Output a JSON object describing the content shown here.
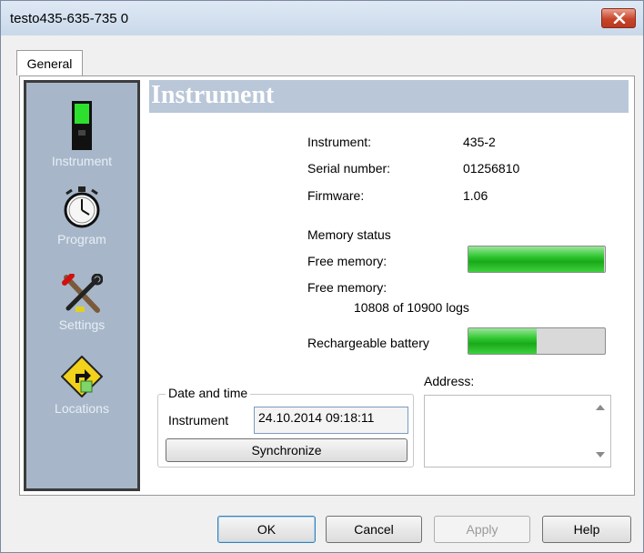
{
  "window": {
    "title": "testo435-635-735 0"
  },
  "tabs": [
    {
      "label": "General"
    }
  ],
  "sidebar": {
    "items": [
      {
        "label": "Instrument",
        "icon": "instrument-icon"
      },
      {
        "label": "Program",
        "icon": "stopwatch-icon"
      },
      {
        "label": "Settings",
        "icon": "tools-icon"
      },
      {
        "label": "Locations",
        "icon": "road-sign-icon"
      }
    ]
  },
  "panel": {
    "header": "Instrument",
    "info": {
      "instrument_label": "Instrument:",
      "instrument_value": "435-2",
      "serial_label": "Serial number:",
      "serial_value": "01256810",
      "firmware_label": "Firmware:",
      "firmware_value": "1.06"
    },
    "memory": {
      "heading": "Memory status",
      "free_memory_label": "Free memory:",
      "free_memory_fraction": 0.99,
      "free_memory_text_label": "Free memory:",
      "free_memory_text": "10808 of 10900 logs",
      "battery_label": "Rechargeable battery",
      "battery_fraction": 0.5
    },
    "datetime": {
      "group_title": "Date and time",
      "instrument_label": "Instrument",
      "value": "24.10.2014 09:18:11",
      "sync_button": "Synchronize"
    },
    "address": {
      "label": "Address:",
      "value": ""
    }
  },
  "buttons": {
    "ok": "OK",
    "cancel": "Cancel",
    "apply": "Apply",
    "help": "Help"
  },
  "colors": {
    "accent_green": "#22bb22",
    "sidebar_bg": "#a7b7c9",
    "header_bg": "#b9c7d8",
    "close_red": "#c7452a"
  }
}
